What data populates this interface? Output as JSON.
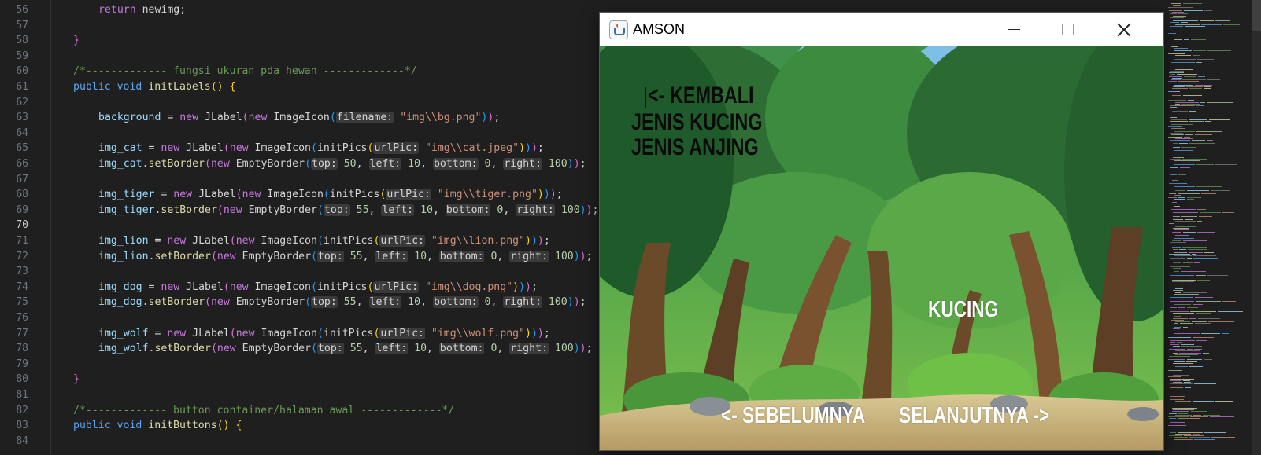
{
  "editor": {
    "active_line": 70,
    "lines": [
      {
        "n": 56,
        "indent": 2,
        "tokens": [
          [
            "kw",
            "return "
          ],
          [
            "plain",
            "newimg;"
          ]
        ]
      },
      {
        "n": 57,
        "indent": 0,
        "tokens": []
      },
      {
        "n": 58,
        "indent": 1,
        "tokens": [
          [
            "brace",
            "}"
          ]
        ]
      },
      {
        "n": 59,
        "indent": 0,
        "tokens": []
      },
      {
        "n": 60,
        "indent": 1,
        "tokens": [
          [
            "cmt",
            "/*------------- fungsi ukuran pda hewan -------------*/"
          ]
        ]
      },
      {
        "n": 61,
        "indent": 1,
        "tokens": [
          [
            "kw2",
            "public "
          ],
          [
            "kw2",
            "void "
          ],
          [
            "fn",
            "initLabels"
          ],
          [
            "paren1",
            "() "
          ],
          [
            "paren1",
            "{"
          ]
        ]
      },
      {
        "n": 62,
        "indent": 0,
        "tokens": []
      },
      {
        "n": 63,
        "indent": 2,
        "tokens": [
          [
            "var",
            "background"
          ],
          [
            "plain",
            " = "
          ],
          [
            "kw",
            "new "
          ],
          [
            "plain",
            "JLabel"
          ],
          [
            "paren2",
            "("
          ],
          [
            "kw",
            "new "
          ],
          [
            "plain",
            "ImageIcon"
          ],
          [
            "paren3",
            "("
          ],
          [
            "hint",
            "filename:"
          ],
          [
            "plain",
            " "
          ],
          [
            "str",
            "\"img\\\\bg.png\""
          ],
          [
            "paren3",
            ")"
          ],
          [
            "paren2",
            ")"
          ],
          [
            "plain",
            ";"
          ]
        ]
      },
      {
        "n": 64,
        "indent": 0,
        "tokens": []
      },
      {
        "n": 65,
        "indent": 2,
        "tokens": [
          [
            "var",
            "img_cat"
          ],
          [
            "plain",
            " = "
          ],
          [
            "kw",
            "new "
          ],
          [
            "plain",
            "JLabel"
          ],
          [
            "paren2",
            "("
          ],
          [
            "kw",
            "new "
          ],
          [
            "plain",
            "ImageIcon"
          ],
          [
            "paren3",
            "("
          ],
          [
            "plain",
            "initPics"
          ],
          [
            "paren1",
            "("
          ],
          [
            "hint",
            "urlPic:"
          ],
          [
            "plain",
            " "
          ],
          [
            "str",
            "\"img\\\\cat.jpeg\""
          ],
          [
            "paren1",
            ")"
          ],
          [
            "paren3",
            ")"
          ],
          [
            "paren2",
            ")"
          ],
          [
            "plain",
            ";"
          ]
        ]
      },
      {
        "n": 66,
        "indent": 2,
        "tokens": [
          [
            "var",
            "img_cat"
          ],
          [
            "plain",
            "."
          ],
          [
            "fn",
            "setBorder"
          ],
          [
            "paren2",
            "("
          ],
          [
            "kw",
            "new "
          ],
          [
            "plain",
            "EmptyBorder"
          ],
          [
            "paren3",
            "("
          ],
          [
            "hint",
            "top:"
          ],
          [
            "plain",
            " "
          ],
          [
            "num",
            "50"
          ],
          [
            "plain",
            ", "
          ],
          [
            "hint",
            "left:"
          ],
          [
            "plain",
            " "
          ],
          [
            "num",
            "10"
          ],
          [
            "plain",
            ", "
          ],
          [
            "hint",
            "bottom:"
          ],
          [
            "plain",
            " "
          ],
          [
            "num",
            "0"
          ],
          [
            "plain",
            ", "
          ],
          [
            "hint",
            "right:"
          ],
          [
            "plain",
            " "
          ],
          [
            "num",
            "100"
          ],
          [
            "paren3",
            ")"
          ],
          [
            "paren2",
            ")"
          ],
          [
            "plain",
            ";"
          ]
        ]
      },
      {
        "n": 67,
        "indent": 0,
        "tokens": []
      },
      {
        "n": 68,
        "indent": 2,
        "tokens": [
          [
            "var",
            "img_tiger"
          ],
          [
            "plain",
            " = "
          ],
          [
            "kw",
            "new "
          ],
          [
            "plain",
            "JLabel"
          ],
          [
            "paren2",
            "("
          ],
          [
            "kw",
            "new "
          ],
          [
            "plain",
            "ImageIcon"
          ],
          [
            "paren3",
            "("
          ],
          [
            "plain",
            "initPics"
          ],
          [
            "paren1",
            "("
          ],
          [
            "hint",
            "urlPic:"
          ],
          [
            "plain",
            " "
          ],
          [
            "str",
            "\"img\\\\tiger.png\""
          ],
          [
            "paren1",
            ")"
          ],
          [
            "paren3",
            ")"
          ],
          [
            "paren2",
            ")"
          ],
          [
            "plain",
            ";"
          ]
        ]
      },
      {
        "n": 69,
        "indent": 2,
        "tokens": [
          [
            "var",
            "img_tiger"
          ],
          [
            "plain",
            "."
          ],
          [
            "fn",
            "setBorder"
          ],
          [
            "paren2",
            "("
          ],
          [
            "kw",
            "new "
          ],
          [
            "plain",
            "EmptyBorder"
          ],
          [
            "paren3",
            "("
          ],
          [
            "hint",
            "top:"
          ],
          [
            "plain",
            " "
          ],
          [
            "num",
            "55"
          ],
          [
            "plain",
            ", "
          ],
          [
            "hint",
            "left:"
          ],
          [
            "plain",
            " "
          ],
          [
            "num",
            "10"
          ],
          [
            "plain",
            ", "
          ],
          [
            "hint",
            "bottom:"
          ],
          [
            "plain",
            " "
          ],
          [
            "num",
            "0"
          ],
          [
            "plain",
            ", "
          ],
          [
            "hint",
            "right:"
          ],
          [
            "plain",
            " "
          ],
          [
            "num",
            "100"
          ],
          [
            "paren3",
            ")"
          ],
          [
            "paren2",
            ")"
          ],
          [
            "plain",
            ";"
          ]
        ]
      },
      {
        "n": 70,
        "indent": 0,
        "tokens": []
      },
      {
        "n": 71,
        "indent": 2,
        "tokens": [
          [
            "var",
            "img_lion"
          ],
          [
            "plain",
            " = "
          ],
          [
            "kw",
            "new "
          ],
          [
            "plain",
            "JLabel"
          ],
          [
            "paren2",
            "("
          ],
          [
            "kw",
            "new "
          ],
          [
            "plain",
            "ImageIcon"
          ],
          [
            "paren3",
            "("
          ],
          [
            "plain",
            "initPics"
          ],
          [
            "paren1",
            "("
          ],
          [
            "hint",
            "urlPic:"
          ],
          [
            "plain",
            " "
          ],
          [
            "str",
            "\"img\\\\lion.png\""
          ],
          [
            "paren1",
            ")"
          ],
          [
            "paren3",
            ")"
          ],
          [
            "paren2",
            ")"
          ],
          [
            "plain",
            ";"
          ]
        ]
      },
      {
        "n": 72,
        "indent": 2,
        "tokens": [
          [
            "var",
            "img_lion"
          ],
          [
            "plain",
            "."
          ],
          [
            "fn",
            "setBorder"
          ],
          [
            "paren2",
            "("
          ],
          [
            "kw",
            "new "
          ],
          [
            "plain",
            "EmptyBorder"
          ],
          [
            "paren3",
            "("
          ],
          [
            "hint",
            "top:"
          ],
          [
            "plain",
            " "
          ],
          [
            "num",
            "55"
          ],
          [
            "plain",
            ", "
          ],
          [
            "hint",
            "left:"
          ],
          [
            "plain",
            " "
          ],
          [
            "num",
            "10"
          ],
          [
            "plain",
            ", "
          ],
          [
            "hint",
            "bottom:"
          ],
          [
            "plain",
            " "
          ],
          [
            "num",
            "0"
          ],
          [
            "plain",
            ", "
          ],
          [
            "hint",
            "right:"
          ],
          [
            "plain",
            " "
          ],
          [
            "num",
            "100"
          ],
          [
            "paren3",
            ")"
          ],
          [
            "paren2",
            ")"
          ],
          [
            "plain",
            ";"
          ]
        ]
      },
      {
        "n": 73,
        "indent": 0,
        "tokens": []
      },
      {
        "n": 74,
        "indent": 2,
        "tokens": [
          [
            "var",
            "img_dog"
          ],
          [
            "plain",
            " = "
          ],
          [
            "kw",
            "new "
          ],
          [
            "plain",
            "JLabel"
          ],
          [
            "paren2",
            "("
          ],
          [
            "kw",
            "new "
          ],
          [
            "plain",
            "ImageIcon"
          ],
          [
            "paren3",
            "("
          ],
          [
            "plain",
            "initPics"
          ],
          [
            "paren1",
            "("
          ],
          [
            "hint",
            "urlPic:"
          ],
          [
            "plain",
            " "
          ],
          [
            "str",
            "\"img\\\\dog.png\""
          ],
          [
            "paren1",
            ")"
          ],
          [
            "paren3",
            ")"
          ],
          [
            "paren2",
            ")"
          ],
          [
            "plain",
            ";"
          ]
        ]
      },
      {
        "n": 75,
        "indent": 2,
        "tokens": [
          [
            "var",
            "img_dog"
          ],
          [
            "plain",
            "."
          ],
          [
            "fn",
            "setBorder"
          ],
          [
            "paren2",
            "("
          ],
          [
            "kw",
            "new "
          ],
          [
            "plain",
            "EmptyBorder"
          ],
          [
            "paren3",
            "("
          ],
          [
            "hint",
            "top:"
          ],
          [
            "plain",
            " "
          ],
          [
            "num",
            "55"
          ],
          [
            "plain",
            ", "
          ],
          [
            "hint",
            "left:"
          ],
          [
            "plain",
            " "
          ],
          [
            "num",
            "10"
          ],
          [
            "plain",
            ", "
          ],
          [
            "hint",
            "bottom:"
          ],
          [
            "plain",
            " "
          ],
          [
            "num",
            "0"
          ],
          [
            "plain",
            ", "
          ],
          [
            "hint",
            "right:"
          ],
          [
            "plain",
            " "
          ],
          [
            "num",
            "100"
          ],
          [
            "paren3",
            ")"
          ],
          [
            "paren2",
            ")"
          ],
          [
            "plain",
            ";"
          ]
        ]
      },
      {
        "n": 76,
        "indent": 0,
        "tokens": []
      },
      {
        "n": 77,
        "indent": 2,
        "tokens": [
          [
            "var",
            "img_wolf"
          ],
          [
            "plain",
            " = "
          ],
          [
            "kw",
            "new "
          ],
          [
            "plain",
            "JLabel"
          ],
          [
            "paren2",
            "("
          ],
          [
            "kw",
            "new "
          ],
          [
            "plain",
            "ImageIcon"
          ],
          [
            "paren3",
            "("
          ],
          [
            "plain",
            "initPics"
          ],
          [
            "paren1",
            "("
          ],
          [
            "hint",
            "urlPic:"
          ],
          [
            "plain",
            " "
          ],
          [
            "str",
            "\"img\\\\wolf.png\""
          ],
          [
            "paren1",
            ")"
          ],
          [
            "paren3",
            ")"
          ],
          [
            "paren2",
            ")"
          ],
          [
            "plain",
            ";"
          ]
        ]
      },
      {
        "n": 78,
        "indent": 2,
        "tokens": [
          [
            "var",
            "img_wolf"
          ],
          [
            "plain",
            "."
          ],
          [
            "fn",
            "setBorder"
          ],
          [
            "paren2",
            "("
          ],
          [
            "kw",
            "new "
          ],
          [
            "plain",
            "EmptyBorder"
          ],
          [
            "paren3",
            "("
          ],
          [
            "hint",
            "top:"
          ],
          [
            "plain",
            " "
          ],
          [
            "num",
            "55"
          ],
          [
            "plain",
            ", "
          ],
          [
            "hint",
            "left:"
          ],
          [
            "plain",
            " "
          ],
          [
            "num",
            "10"
          ],
          [
            "plain",
            ", "
          ],
          [
            "hint",
            "bottom:"
          ],
          [
            "plain",
            " "
          ],
          [
            "num",
            "0"
          ],
          [
            "plain",
            ", "
          ],
          [
            "hint",
            "right:"
          ],
          [
            "plain",
            " "
          ],
          [
            "num",
            "100"
          ],
          [
            "paren3",
            ")"
          ],
          [
            "paren2",
            ")"
          ],
          [
            "plain",
            ";"
          ]
        ]
      },
      {
        "n": 79,
        "indent": 0,
        "tokens": []
      },
      {
        "n": 80,
        "indent": 1,
        "tokens": [
          [
            "brace",
            "}"
          ]
        ]
      },
      {
        "n": 81,
        "indent": 0,
        "tokens": []
      },
      {
        "n": 82,
        "indent": 1,
        "tokens": [
          [
            "cmt",
            "/*------------- button container/halaman awal -------------*/"
          ]
        ]
      },
      {
        "n": 83,
        "indent": 1,
        "tokens": [
          [
            "kw2",
            "public "
          ],
          [
            "kw2",
            "void "
          ],
          [
            "fn",
            "initButtons"
          ],
          [
            "paren1",
            "() "
          ],
          [
            "paren1",
            "{"
          ]
        ]
      },
      {
        "n": 84,
        "indent": 0,
        "tokens": []
      }
    ]
  },
  "window": {
    "title": "AMSON",
    "icon": "java-cup-icon",
    "labels": {
      "back": "<- KEMBALI",
      "cat_types": "JENIS KUCING",
      "dog_types": "JENIS ANJING",
      "current": "KUCING",
      "prev": "<- SEBELUMNYA",
      "next": "SELANJUTNYA ->"
    }
  },
  "colors": {
    "editor_bg": "#1f1f1f",
    "keyword": "#c678dd",
    "string": "#ce9178",
    "comment": "#6a9955",
    "sky": "#5fa0d8",
    "forest_dark": "#1f5a2a",
    "path": "#cdb98a"
  }
}
